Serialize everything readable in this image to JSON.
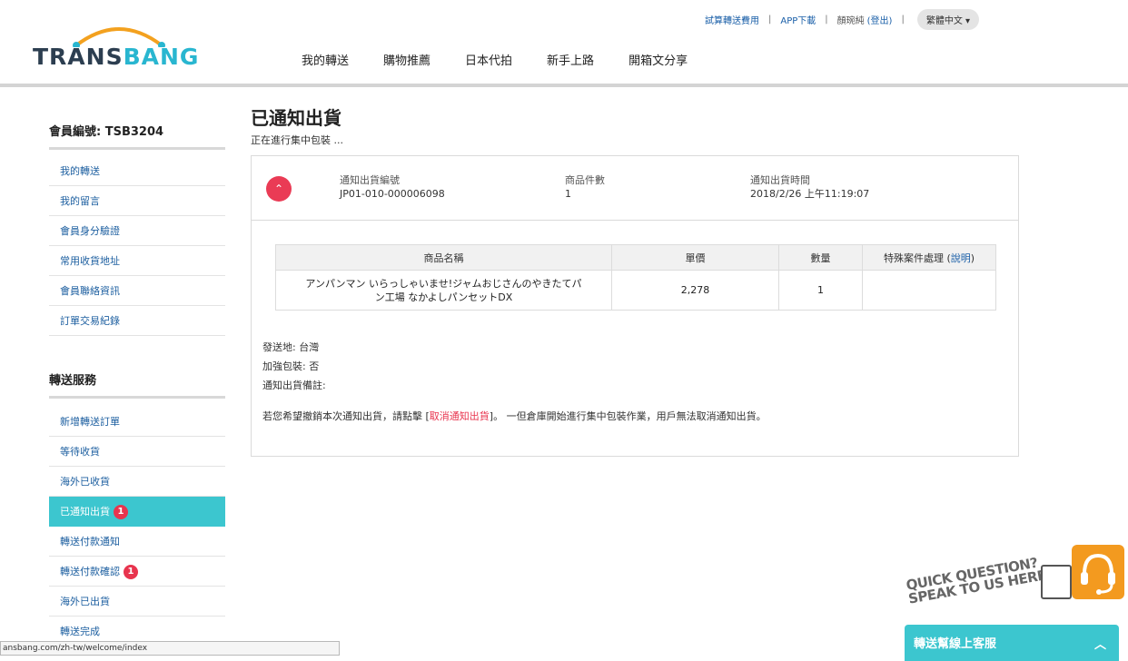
{
  "header": {
    "top_links": [
      "試算轉送費用",
      "APP下載",
      "顏琬純",
      "(登出)"
    ],
    "language": "繁體中文 ▾",
    "logo_text_dark": "TRANS",
    "logo_text_teal": "BANG",
    "nav": [
      "我的轉送",
      "購物推薦",
      "日本代拍",
      "新手上路",
      "開箱文分享"
    ]
  },
  "sidebar": {
    "member_id": "會員編號: TSB3204",
    "account_items": [
      "我的轉送",
      "我的留言",
      "會員身分驗證",
      "常用收貨地址",
      "會員聯絡資訊",
      "訂單交易紀錄"
    ],
    "service_heading": "轉送服務",
    "service_items": [
      {
        "label": "新增轉送訂單",
        "badge": ""
      },
      {
        "label": "等待收貨",
        "badge": ""
      },
      {
        "label": "海外已收貨",
        "badge": ""
      },
      {
        "label": "已通知出貨",
        "badge": "1"
      },
      {
        "label": "轉送付款通知",
        "badge": ""
      },
      {
        "label": "轉送付款確認",
        "badge": "1"
      },
      {
        "label": "海外已出貨",
        "badge": ""
      },
      {
        "label": "轉送完成",
        "badge": ""
      }
    ]
  },
  "main": {
    "title": "已通知出貨",
    "subtitle": "正在進行集中包裝 ...",
    "shipment": {
      "toggle_glyph": "⌃",
      "id_label": "通知出貨編號",
      "id_value": "JP01-010-000006098",
      "count_label": "商品件數",
      "count_value": "1",
      "time_label": "通知出貨時間",
      "time_value": "2018/2/26 上午11:19:07"
    },
    "table": {
      "headers": [
        "商品名稱",
        "單價",
        "數量",
        "特殊案件處理 (",
        "說明",
        ")"
      ],
      "rows": [
        {
          "name_line1": "アンパンマン いらっしゃいませ!ジャムおじさんのやきたてパ",
          "name_line2": "ン工場 なかよしパンセットDX",
          "price": "2,278",
          "qty": "1",
          "special": ""
        }
      ]
    },
    "origin": "發送地: 台灣",
    "reinforce": "加強包裝: 否",
    "note": "通知出貨備註:",
    "cancel_before": "若您希望撤銷本次通知出貨，請點擊 [",
    "cancel_link": "取消通知出貨",
    "cancel_after": "]。 一但倉庫開始進行集中包裝作業，用戶無法取消通知出貨。"
  },
  "support": {
    "quick_line1": "QUICK QUESTION?",
    "quick_line2": "SPEAK TO US HERE!",
    "bar_label": "轉送幫線上客服",
    "bar_chevron": "︿"
  },
  "status_bar": {
    "url": "ansbang.com/zh-tw/welcome/index"
  },
  "colors": {
    "accent_teal": "#3cc6cf",
    "badge_red": "#e8344e",
    "link_blue": "#1d5fa0",
    "support_orange": "#f39a1f"
  }
}
